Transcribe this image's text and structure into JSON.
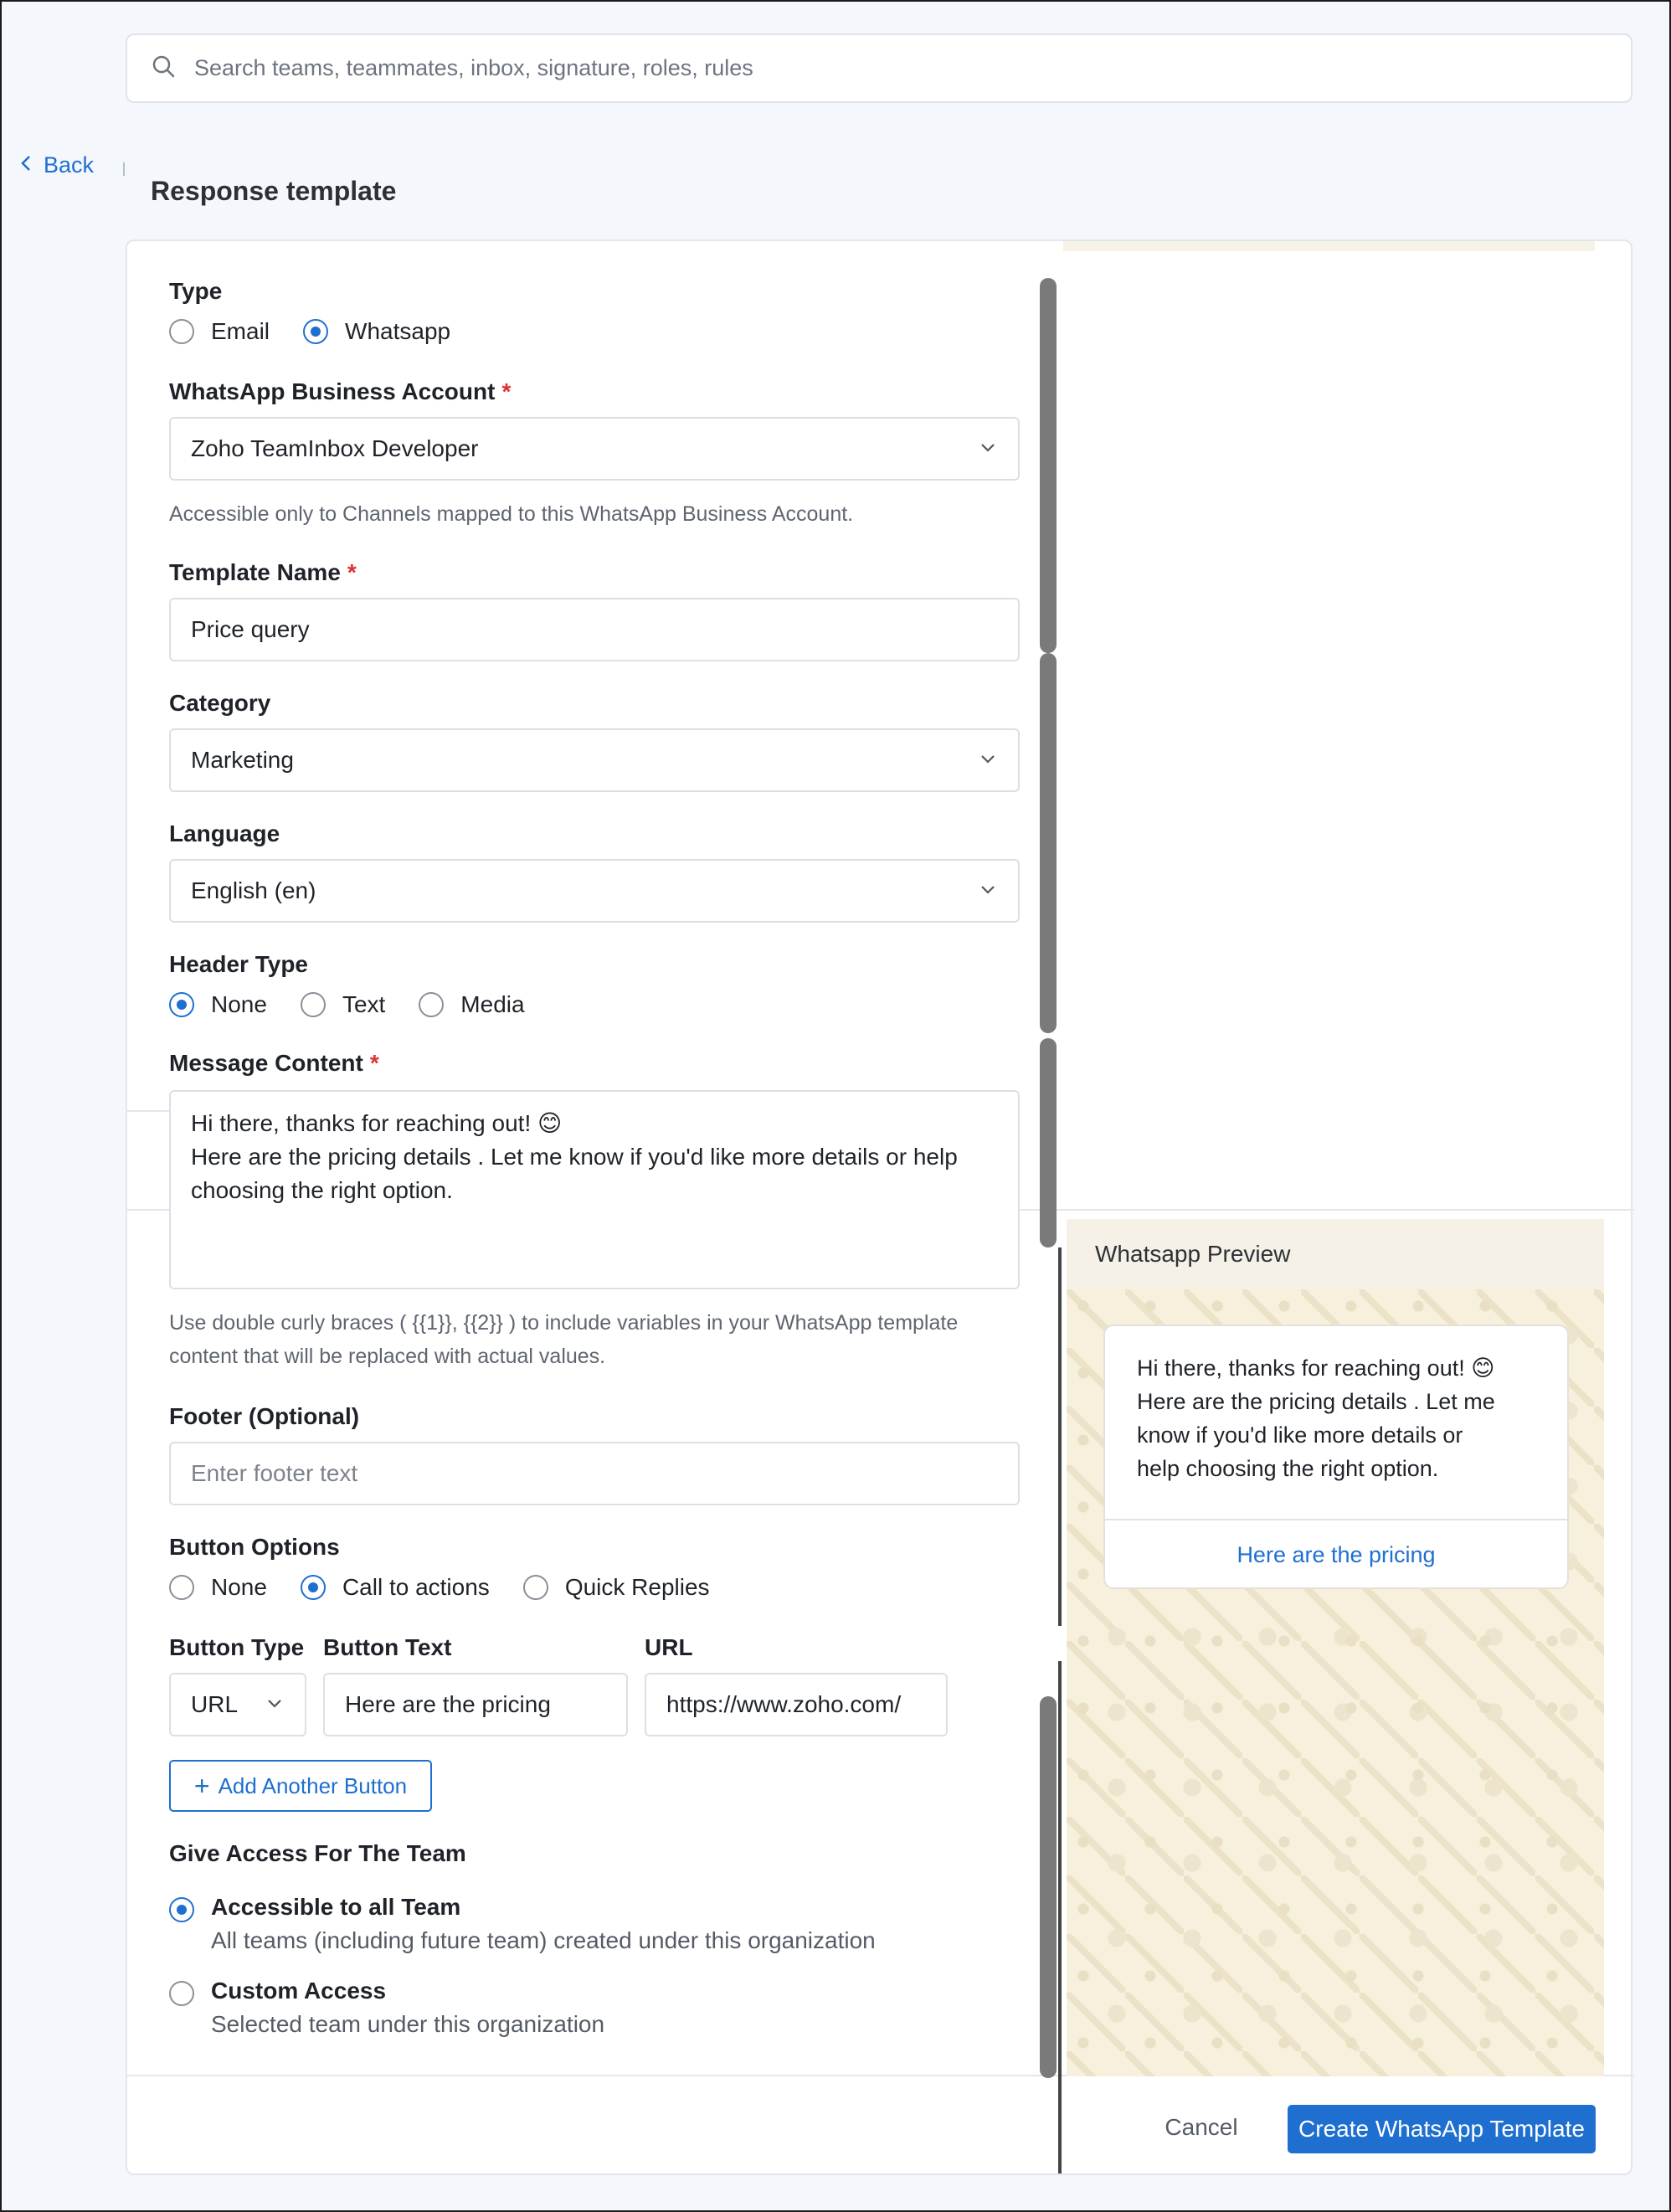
{
  "search": {
    "placeholder": "Search teams, teammates, inbox, signature, roles, rules"
  },
  "nav": {
    "back_label": "Back"
  },
  "page": {
    "title": "Response template"
  },
  "form": {
    "type": {
      "label": "Type",
      "options": [
        "Email",
        "Whatsapp"
      ],
      "selected": "Whatsapp"
    },
    "waba": {
      "label": "WhatsApp Business Account",
      "required_mark": "*",
      "value": "Zoho TeamInbox Developer",
      "hint": "Accessible only to Channels mapped to this WhatsApp Business Account."
    },
    "template_name": {
      "label": "Template Name",
      "required_mark": "*",
      "value": "Price query"
    },
    "category": {
      "label": "Category",
      "value": "Marketing"
    },
    "language": {
      "label": "Language",
      "value": "English (en)"
    },
    "header_type": {
      "label": "Header Type",
      "options": [
        "None",
        "Text",
        "Media"
      ],
      "selected": "None"
    },
    "message": {
      "label": "Message Content",
      "required_mark": "*",
      "value": "Hi there, thanks for reaching out! 😊\nHere are the pricing details . Let me know if you'd like more details or help choosing the right option.",
      "hint_line1": "Use double curly braces ( {{1}}, {{2}} ) to include variables in your WhatsApp template",
      "hint_line2": "content that will be replaced with actual values."
    },
    "footer": {
      "label": "Footer (Optional)",
      "placeholder": "Enter footer text"
    },
    "button_options": {
      "label": "Button Options",
      "options": [
        "None",
        "Call to actions",
        "Quick Replies"
      ],
      "selected": "Call to actions"
    },
    "button_row": {
      "type_label": "Button Type",
      "text_label": "Button Text",
      "url_label": "URL",
      "type_value": "URL",
      "text_value": "Here are the pricing",
      "url_value": "https://www.zoho.com/"
    },
    "add_button_label": "Add Another Button",
    "access": {
      "label": "Give Access For The Team",
      "options": [
        {
          "title": "Accessible to all Team",
          "subtitle": "All teams (including future team) created under this organization",
          "selected": true
        },
        {
          "title": "Custom Access",
          "subtitle": "Selected team under this organization",
          "selected": false
        }
      ]
    }
  },
  "preview": {
    "title": "Whatsapp Preview",
    "message": "Hi there, thanks for reaching out! 😊\nHere are the pricing details . Let me\nknow if you'd like more details or\nhelp choosing the right option.",
    "button_label": "Here are the pricing"
  },
  "footer_actions": {
    "cancel_label": "Cancel",
    "create_label": "Create WhatsApp Template"
  },
  "colors": {
    "accent": "#1f6fd1",
    "required": "#e0312f",
    "preview_bg": "#f6f0dc"
  }
}
